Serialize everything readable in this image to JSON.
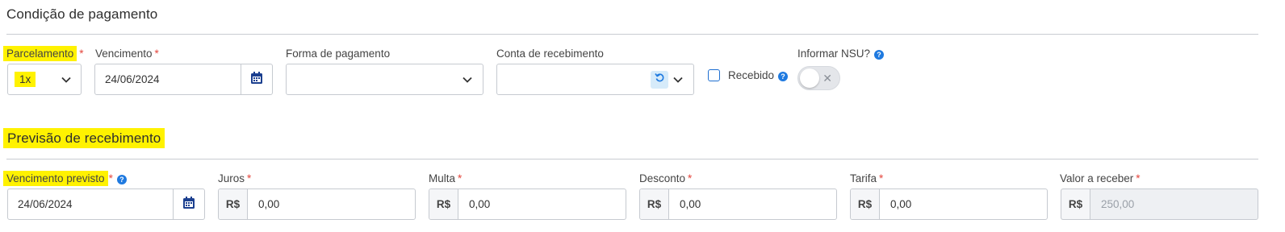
{
  "condicao": {
    "title": "Condição de pagamento",
    "parcelamento": {
      "label": "Parcelamento",
      "required": "*",
      "value": "1x",
      "icon": "chevron-down-icon"
    },
    "vencimento": {
      "label": "Vencimento",
      "required": "*",
      "value": "24/06/2024",
      "icon": "calendar-icon"
    },
    "forma_pagamento": {
      "label": "Forma de pagamento",
      "value": "",
      "icon": "chevron-down-icon"
    },
    "conta_recebimento": {
      "label": "Conta de recebimento",
      "value": "",
      "icons": [
        "refresh-icon",
        "chevron-down-icon"
      ]
    },
    "recebido": {
      "label": "Recebido",
      "checked": false,
      "help_icon": "question-icon"
    },
    "informar_nsu": {
      "label": "Informar NSU?",
      "on": false,
      "help_icon": "question-icon",
      "off_glyph": "✕"
    }
  },
  "previsao": {
    "title": "Previsão de recebimento",
    "vencimento_previsto": {
      "label": "Vencimento previsto",
      "required": "*",
      "value": "24/06/2024",
      "help_icon": "question-icon"
    },
    "currency": "R$",
    "juros": {
      "label": "Juros",
      "required": "*",
      "value": "0,00"
    },
    "multa": {
      "label": "Multa",
      "required": "*",
      "value": "0,00"
    },
    "desconto": {
      "label": "Desconto",
      "required": "*",
      "value": "0,00"
    },
    "tarifa": {
      "label": "Tarifa",
      "required": "*",
      "value": "0,00"
    },
    "valor_a_receber": {
      "label": "Valor a receber",
      "required": "*",
      "value": "250,00",
      "disabled": true
    }
  },
  "help_glyph": "?",
  "colors": {
    "highlight": "#fff200",
    "required": "#e4453c",
    "accent": "#1f6fd1",
    "calendar": "#1b3f8f"
  }
}
